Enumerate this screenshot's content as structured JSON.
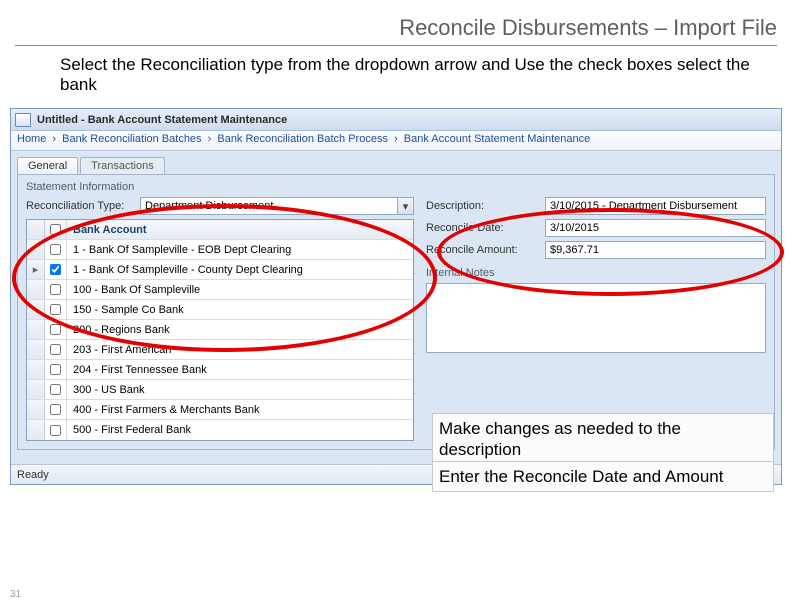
{
  "slide": {
    "title": "Reconcile Disbursements – Import File",
    "instruction_top": "Select the Reconciliation type from the dropdown arrow and Use the check boxes select the bank",
    "instruction_mid": "Make changes as needed to the description",
    "instruction_bottom": "Enter the Reconcile Date and Amount",
    "page_number": "31"
  },
  "window": {
    "title": "Untitled - Bank Account Statement Maintenance"
  },
  "breadcrumb": {
    "items": [
      "Home",
      "Bank Reconciliation Batches",
      "Bank Reconciliation Batch Process",
      "Bank Account Statement Maintenance"
    ]
  },
  "tabs": {
    "general": "General",
    "transactions": "Transactions"
  },
  "section": {
    "statement_info": "Statement Information"
  },
  "form": {
    "reconciliation_type_label": "Reconciliation Type:",
    "reconciliation_type_value": "Department Disbursement",
    "description_label": "Description:",
    "description_value": "3/10/2015 - Department Disbursement",
    "reconcile_date_label": "Reconcile Date:",
    "reconcile_date_value": "3/10/2015",
    "reconcile_amount_label": "Reconcile Amount:",
    "reconcile_amount_value": "$9,367.71",
    "internal_notes_label": "Internal Notes"
  },
  "grid": {
    "header": "Bank Account",
    "rows": [
      {
        "checked": false,
        "label": "1 - Bank Of Sampleville - EOB Dept Clearing"
      },
      {
        "checked": true,
        "label": "1 - Bank Of Sampleville - County Dept Clearing"
      },
      {
        "checked": false,
        "label": "100 - Bank Of Sampleville"
      },
      {
        "checked": false,
        "label": "150 - Sample Co Bank"
      },
      {
        "checked": false,
        "label": "200 - Regions Bank"
      },
      {
        "checked": false,
        "label": "203 - First American"
      },
      {
        "checked": false,
        "label": "204 - First Tennessee Bank"
      },
      {
        "checked": false,
        "label": "300 - US Bank"
      },
      {
        "checked": false,
        "label": "400 - First Farmers & Merchants Bank"
      },
      {
        "checked": false,
        "label": "500 - First Federal Bank"
      }
    ]
  },
  "statusbar": {
    "text": "Ready"
  }
}
